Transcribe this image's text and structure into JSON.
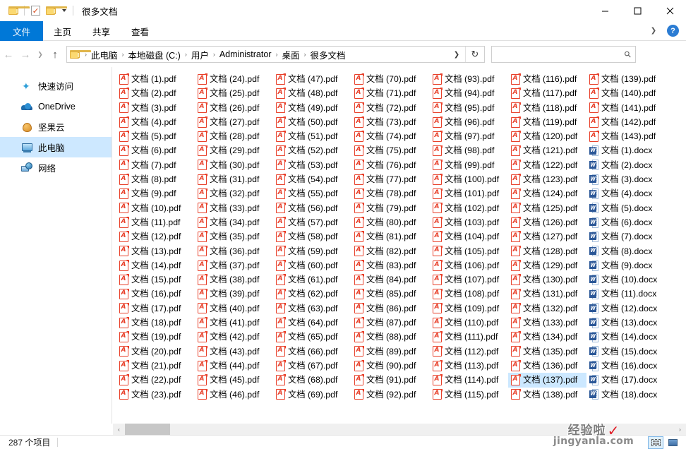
{
  "window": {
    "title": "很多文档",
    "quick_access_icons": [
      "folder-icon",
      "properties-check-icon",
      "new-folder-icon"
    ],
    "qat_dropdown": "customize-quick-access-toolbar",
    "controls": {
      "minimize": "–",
      "maximize": "☐",
      "close": "✕"
    }
  },
  "ribbon": {
    "tabs": [
      {
        "label": "文件",
        "active": true
      },
      {
        "label": "主页",
        "active": false
      },
      {
        "label": "共享",
        "active": false
      },
      {
        "label": "查看",
        "active": false
      }
    ],
    "collapse_icon": "chevron-down-icon",
    "help_label": "?"
  },
  "nav": {
    "back": "←",
    "forward": "→",
    "recent": "⌄",
    "up": "↑",
    "breadcrumbs": [
      "此电脑",
      "本地磁盘 (C:)",
      "用户",
      "Administrator",
      "桌面",
      "很多文档"
    ],
    "separator": "›",
    "dropdown_icon": "chevron-down-icon",
    "refresh_icon": "↻",
    "search": {
      "value": "",
      "placeholder": ""
    }
  },
  "sidebar": {
    "items": [
      {
        "label": "快速访问",
        "icon": "star-icon",
        "selected": false
      },
      {
        "label": "OneDrive",
        "icon": "cloud-icon",
        "selected": false
      },
      {
        "label": "坚果云",
        "icon": "nut-icon",
        "selected": false
      },
      {
        "label": "此电脑",
        "icon": "monitor-icon",
        "selected": true
      },
      {
        "label": "网络",
        "icon": "network-icon",
        "selected": false
      }
    ]
  },
  "files": {
    "selected_name": "文档 (137).pdf",
    "pdf_prefix": "文档 (",
    "pdf_suffix": ").pdf",
    "docx_suffix": ").docx",
    "pdf_count": 143,
    "docx_count": 18,
    "items_per_column": 23,
    "columns": [
      {
        "type": "pdf",
        "start": 1,
        "end": 23
      },
      {
        "type": "pdf",
        "start": 24,
        "end": 46
      },
      {
        "type": "pdf",
        "start": 47,
        "end": 69
      },
      {
        "type": "pdf",
        "start": 70,
        "end": 92
      },
      {
        "type": "pdf",
        "start": 93,
        "end": 115
      },
      {
        "type": "pdf",
        "start": 116,
        "end": 138
      },
      {
        "type": "mixed",
        "pdf_start": 139,
        "pdf_end": 143,
        "docx_start": 1,
        "docx_end": 18
      }
    ]
  },
  "scrollbar": {
    "left_arrow": "‹",
    "right_arrow": "›"
  },
  "status": {
    "item_count_text": "287 个项目",
    "view_tiles": "tiles-view-icon",
    "view_details": "details-view-icon"
  },
  "watermark": {
    "brand_cn": "经验啦",
    "check": "✓",
    "url": "jingyanla.com"
  },
  "colors": {
    "accent": "#0078d7",
    "selection": "#cce8ff",
    "pdf_red": "#e8402a",
    "word_blue": "#2b5797",
    "sidebar_selected": "#cde8ff"
  }
}
